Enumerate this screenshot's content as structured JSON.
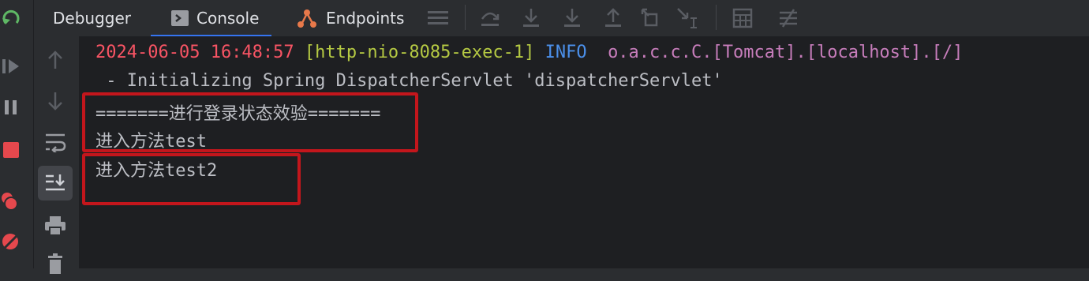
{
  "tabs": [
    {
      "label": "Debugger",
      "icon": "debugger"
    },
    {
      "label": "Console",
      "icon": "console-icon",
      "active": true
    },
    {
      "label": "Endpoints",
      "icon": "endpoints-icon"
    }
  ],
  "log": {
    "date": "2024-06-05 16:48:57",
    "thread": "[http-nio-8085-exec-1]",
    "level": "INFO",
    "logger": "o.a.c.c.C.[Tomcat].[localhost].[/]",
    "message": " - Initializing Spring DispatcherServlet 'dispatcherServlet'"
  },
  "output": {
    "line1": "=======进行登录状态效验=======",
    "line2": "进入方法test",
    "line3": "进入方法test2"
  },
  "colors": {
    "date": "#f75464",
    "thread": "#b5c943",
    "info": "#4b8fe9",
    "logger": "#c77dbb",
    "highlight": "#c3161c",
    "accent": "#3574f0"
  },
  "icons": {
    "rail": [
      "rerun-icon",
      "resume-icon",
      "pause-icon",
      "stop-icon",
      "view-breakpoints-icon",
      "mute-breakpoints-icon"
    ],
    "gutter": [
      "scroll-up-icon",
      "scroll-down-icon",
      "soft-wrap-icon",
      "scroll-to-end-icon",
      "print-icon",
      "clear-icon"
    ],
    "toolbar": [
      "layout-icon",
      "step-over-icon",
      "step-into-icon",
      "force-step-into-icon",
      "step-out-icon",
      "drop-frame-icon",
      "run-to-cursor-icon",
      "evaluate-icon",
      "trace-icon"
    ]
  }
}
